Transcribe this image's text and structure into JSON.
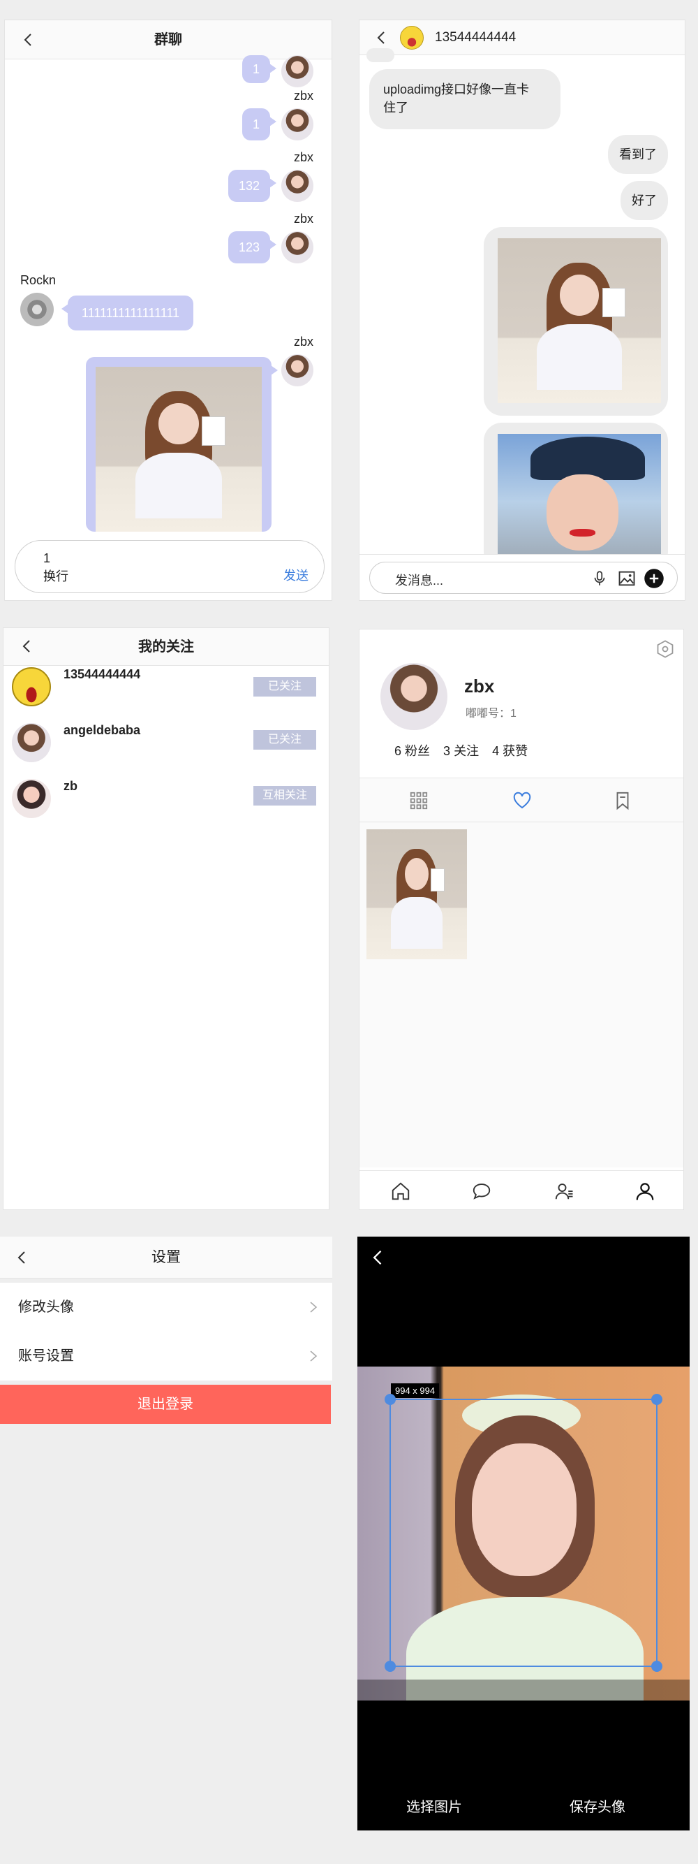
{
  "group_chat": {
    "title": "群聊",
    "messages": [
      {
        "user": "zbx",
        "text": "1"
      },
      {
        "user": "zbx",
        "text": "132"
      },
      {
        "user": "zbx",
        "text": "123"
      },
      {
        "user": "Rockn",
        "text": "1111111111111111"
      },
      {
        "user": "zbx",
        "type": "image"
      }
    ],
    "top_partial_text": "1",
    "input_value": "1\n换行",
    "input_line1": "1",
    "input_line2": "换行",
    "send_label": "发送"
  },
  "direct_chat": {
    "title": "13544444444",
    "messages": [
      {
        "side": "left",
        "text": "uploadimg接口好像一直卡住了"
      },
      {
        "side": "right",
        "text": "看到了"
      },
      {
        "side": "right",
        "text": "好了"
      },
      {
        "side": "right",
        "type": "image"
      },
      {
        "side": "right",
        "type": "image"
      }
    ],
    "msg_left_line1": "uploadimg接口好像一直卡",
    "msg_left_line2": "住了",
    "input_placeholder": "发消息..."
  },
  "following": {
    "title": "我的关注",
    "items": [
      {
        "name": "13544444444",
        "button": "已关注"
      },
      {
        "name": "angeldebaba",
        "button": "已关注"
      },
      {
        "name": "zb",
        "button": "互相关注"
      }
    ]
  },
  "profile": {
    "username": "zbx",
    "id_label": "嘟嘟号：1",
    "stats": [
      {
        "count": "6",
        "label": "粉丝"
      },
      {
        "count": "3",
        "label": "关注"
      },
      {
        "count": "4",
        "label": "获赞"
      }
    ],
    "active_tab": "likes",
    "nav": [
      "home-icon",
      "message-icon",
      "friends-icon",
      "profile-icon"
    ]
  },
  "settings": {
    "title": "设置",
    "items": [
      {
        "label": "修改头像"
      },
      {
        "label": "账号设置"
      }
    ],
    "logout_label": "退出登录",
    "logout_color": "#ff655b"
  },
  "cropper": {
    "size_label": "994 x 994",
    "choose_label": "选择图片",
    "save_label": "保存头像"
  },
  "colors": {
    "bubble": "#c8cbf4",
    "link": "#3b7ddd",
    "follow_button": "#bfc4dc"
  }
}
